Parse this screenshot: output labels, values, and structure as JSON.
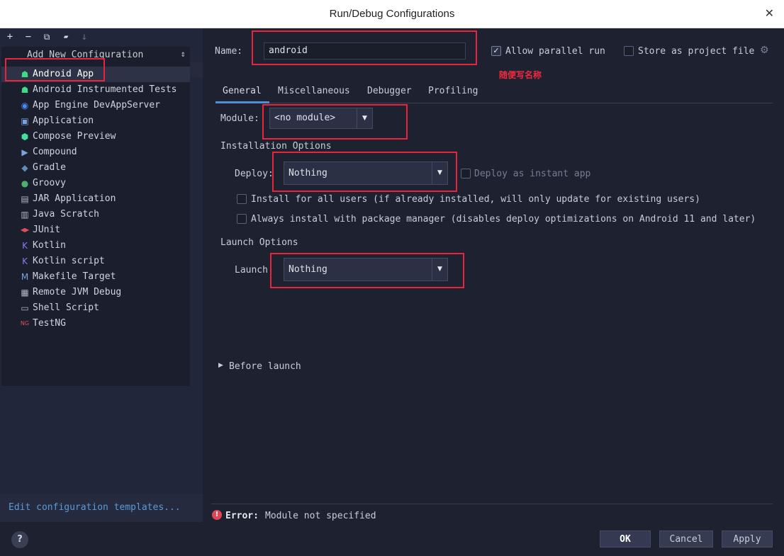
{
  "window": {
    "title": "Run/Debug Configurations",
    "close_glyph": "✕"
  },
  "toolbar": [
    {
      "name": "add-icon",
      "glyph": "+"
    },
    {
      "name": "remove-icon",
      "glyph": "−"
    },
    {
      "name": "copy-icon",
      "glyph": "⧉"
    },
    {
      "name": "folder-icon",
      "glyph": "▰"
    },
    {
      "name": "sort-icon",
      "glyph": "↓"
    }
  ],
  "tree": {
    "header": "Add New Configuration",
    "collapse_glyph": "⇕",
    "items": [
      {
        "label": "Android App",
        "icon": "android-icon",
        "glyph": "☗",
        "color": "#3ddc84"
      },
      {
        "label": "Android Instrumented Tests",
        "icon": "android-test-icon",
        "glyph": "☗",
        "color": "#3ddc84"
      },
      {
        "label": "App Engine DevAppServer",
        "icon": "app-engine-icon",
        "glyph": "◉",
        "color": "#4a8af4"
      },
      {
        "label": "Application",
        "icon": "application-icon",
        "glyph": "▣",
        "color": "#7aa3e0"
      },
      {
        "label": "Compose Preview",
        "icon": "compose-icon",
        "glyph": "⬢",
        "color": "#42e09a"
      },
      {
        "label": "Compound",
        "icon": "compound-icon",
        "glyph": "▶",
        "color": "#7aa3e0"
      },
      {
        "label": "Gradle",
        "icon": "gradle-icon",
        "glyph": "◆",
        "color": "#5f8cbf"
      },
      {
        "label": "Groovy",
        "icon": "groovy-icon",
        "glyph": "●",
        "color": "#4caf6e"
      },
      {
        "label": "JAR Application",
        "icon": "jar-icon",
        "glyph": "▤",
        "color": "#b0b6c8"
      },
      {
        "label": "Java Scratch",
        "icon": "java-scratch-icon",
        "glyph": "▥",
        "color": "#b0b6c8"
      },
      {
        "label": "JUnit",
        "icon": "junit-icon",
        "glyph": "◀▶",
        "color": "#e0505a"
      },
      {
        "label": "Kotlin",
        "icon": "kotlin-icon",
        "glyph": "K",
        "color": "#8a7cf0"
      },
      {
        "label": "Kotlin script",
        "icon": "kotlin-script-icon",
        "glyph": "K",
        "color": "#8a7cf0"
      },
      {
        "label": "Makefile Target",
        "icon": "makefile-icon",
        "glyph": "M",
        "color": "#7aa3e0"
      },
      {
        "label": "Remote JVM Debug",
        "icon": "remote-debug-icon",
        "glyph": "▦",
        "color": "#b0b6c8"
      },
      {
        "label": "Shell Script",
        "icon": "shell-icon",
        "glyph": "▭",
        "color": "#b0b6c8"
      },
      {
        "label": "TestNG",
        "icon": "testng-icon",
        "glyph": "NG",
        "color": "#e0505a"
      }
    ]
  },
  "edit_templates_link": "Edit configuration templates...",
  "help_glyph": "?",
  "name_field": {
    "label": "Name:",
    "value": "android"
  },
  "allow_parallel": {
    "label": "Allow parallel run",
    "checked": true,
    "check_glyph": "✓"
  },
  "store_project": {
    "label": "Store as project file",
    "checked": false,
    "gear_glyph": "⚙"
  },
  "annotation": "随便写名称",
  "tabs": [
    "General",
    "Miscellaneous",
    "Debugger",
    "Profiling"
  ],
  "module": {
    "label": "Module:",
    "value": "<no module>"
  },
  "installation": {
    "heading": "Installation Options",
    "deploy_label": "Deploy:",
    "deploy_value": "Nothing",
    "instant_app_label": "Deploy as instant app",
    "install_all_users": "Install for all users (if already installed, will only update for existing users)",
    "always_install": "Always install with package manager (disables deploy optimizations on Android 11 and later)"
  },
  "launch": {
    "heading": "Launch Options",
    "label": "Launch:",
    "value": "Nothing"
  },
  "dropdown_arrow": "▼",
  "before_launch": {
    "label": "Before launch",
    "glyph": "▶"
  },
  "error": {
    "icon_glyph": "!",
    "prefix": "Error:",
    "message": "Module not specified"
  },
  "buttons": {
    "ok": "OK",
    "cancel": "Cancel",
    "apply": "Apply"
  },
  "colors": {
    "annotation_red": "#e8253c",
    "link_blue": "#5a9bd8",
    "tab_underline": "#4e8fd6"
  }
}
